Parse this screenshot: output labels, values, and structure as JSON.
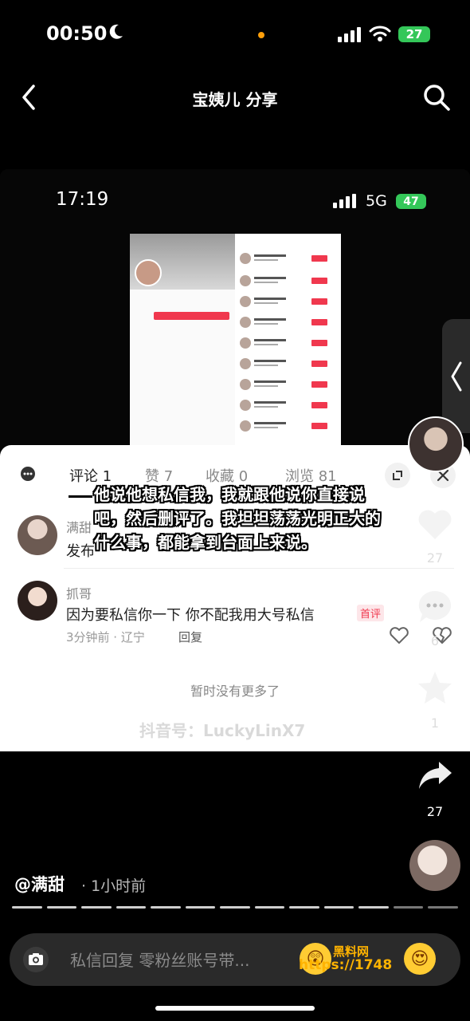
{
  "status_bar": {
    "time": "00:50",
    "battery": "27"
  },
  "header": {
    "title": "宝姨儿 分享"
  },
  "inner_status_bar": {
    "time": "17:19",
    "network": "5G",
    "battery": "47"
  },
  "tabs": [
    {
      "label": "评论 1"
    },
    {
      "label": "赞 7"
    },
    {
      "label": "收藏 0"
    },
    {
      "label": "浏览 81"
    }
  ],
  "comments": [
    {
      "user": "满甜",
      "text": "发布"
    },
    {
      "user": "抓哥",
      "text": "因为要私信你一下 你不配我用大号私信",
      "tag": "首评",
      "meta": "3分钟前 · 辽宁",
      "reply": "回复"
    }
  ],
  "no_more": "暂时没有更多了",
  "watermark": "抖音号：LuckyLinX7",
  "overlay_caption": "他说他想私信我，我就跟他说你直接说吧，然后删评了。我坦坦荡荡光明正大的什么事，都能拿到台面上来说。",
  "rail": {
    "like_count": "27",
    "comment_count": "6",
    "favorite_count": "1",
    "share_count": "27"
  },
  "author": {
    "name": "@满甜",
    "time": "· 1小时前"
  },
  "progress": {
    "segments": 13,
    "done": 11
  },
  "input": {
    "placeholder": "私信回复 零粉丝账号带..."
  },
  "site_watermark": {
    "url": "https://1748",
    "name": "黑料网"
  },
  "icons": [
    "moon-icon",
    "signal-icon",
    "wifi-icon",
    "back-icon",
    "search-icon",
    "chevron-left-icon",
    "resize-icon",
    "close-icon",
    "heart-icon",
    "comment-icon",
    "star-icon",
    "share-icon",
    "camera-icon",
    "emoji-icon"
  ]
}
